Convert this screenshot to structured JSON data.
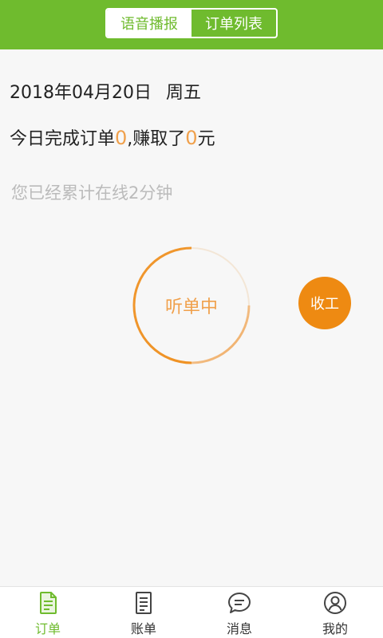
{
  "header": {
    "tabs": [
      {
        "label": "语音播报",
        "active": true
      },
      {
        "label": "订单列表",
        "active": false
      }
    ]
  },
  "today": {
    "date": "2018年04月20日",
    "weekday": "周五",
    "prefix": "今日完成订单",
    "orders": "0",
    "middle": ",赚取了",
    "earnings": "0",
    "suffix": "元"
  },
  "online": {
    "text": "您已经累计在线2分钟"
  },
  "listening": {
    "label": "听单中"
  },
  "stop_button": {
    "label": "收工"
  },
  "tabbar": {
    "items": [
      {
        "label": "订单",
        "icon": "order-icon",
        "active": true
      },
      {
        "label": "账单",
        "icon": "bill-icon",
        "active": false
      },
      {
        "label": "消息",
        "icon": "message-icon",
        "active": false
      },
      {
        "label": "我的",
        "icon": "profile-icon",
        "active": false
      }
    ]
  },
  "colors": {
    "brand_green": "#6fbb2e",
    "accent_orange": "#ee8a12",
    "number_orange": "#f0a04b",
    "hint_gray": "#bbbbbb"
  }
}
